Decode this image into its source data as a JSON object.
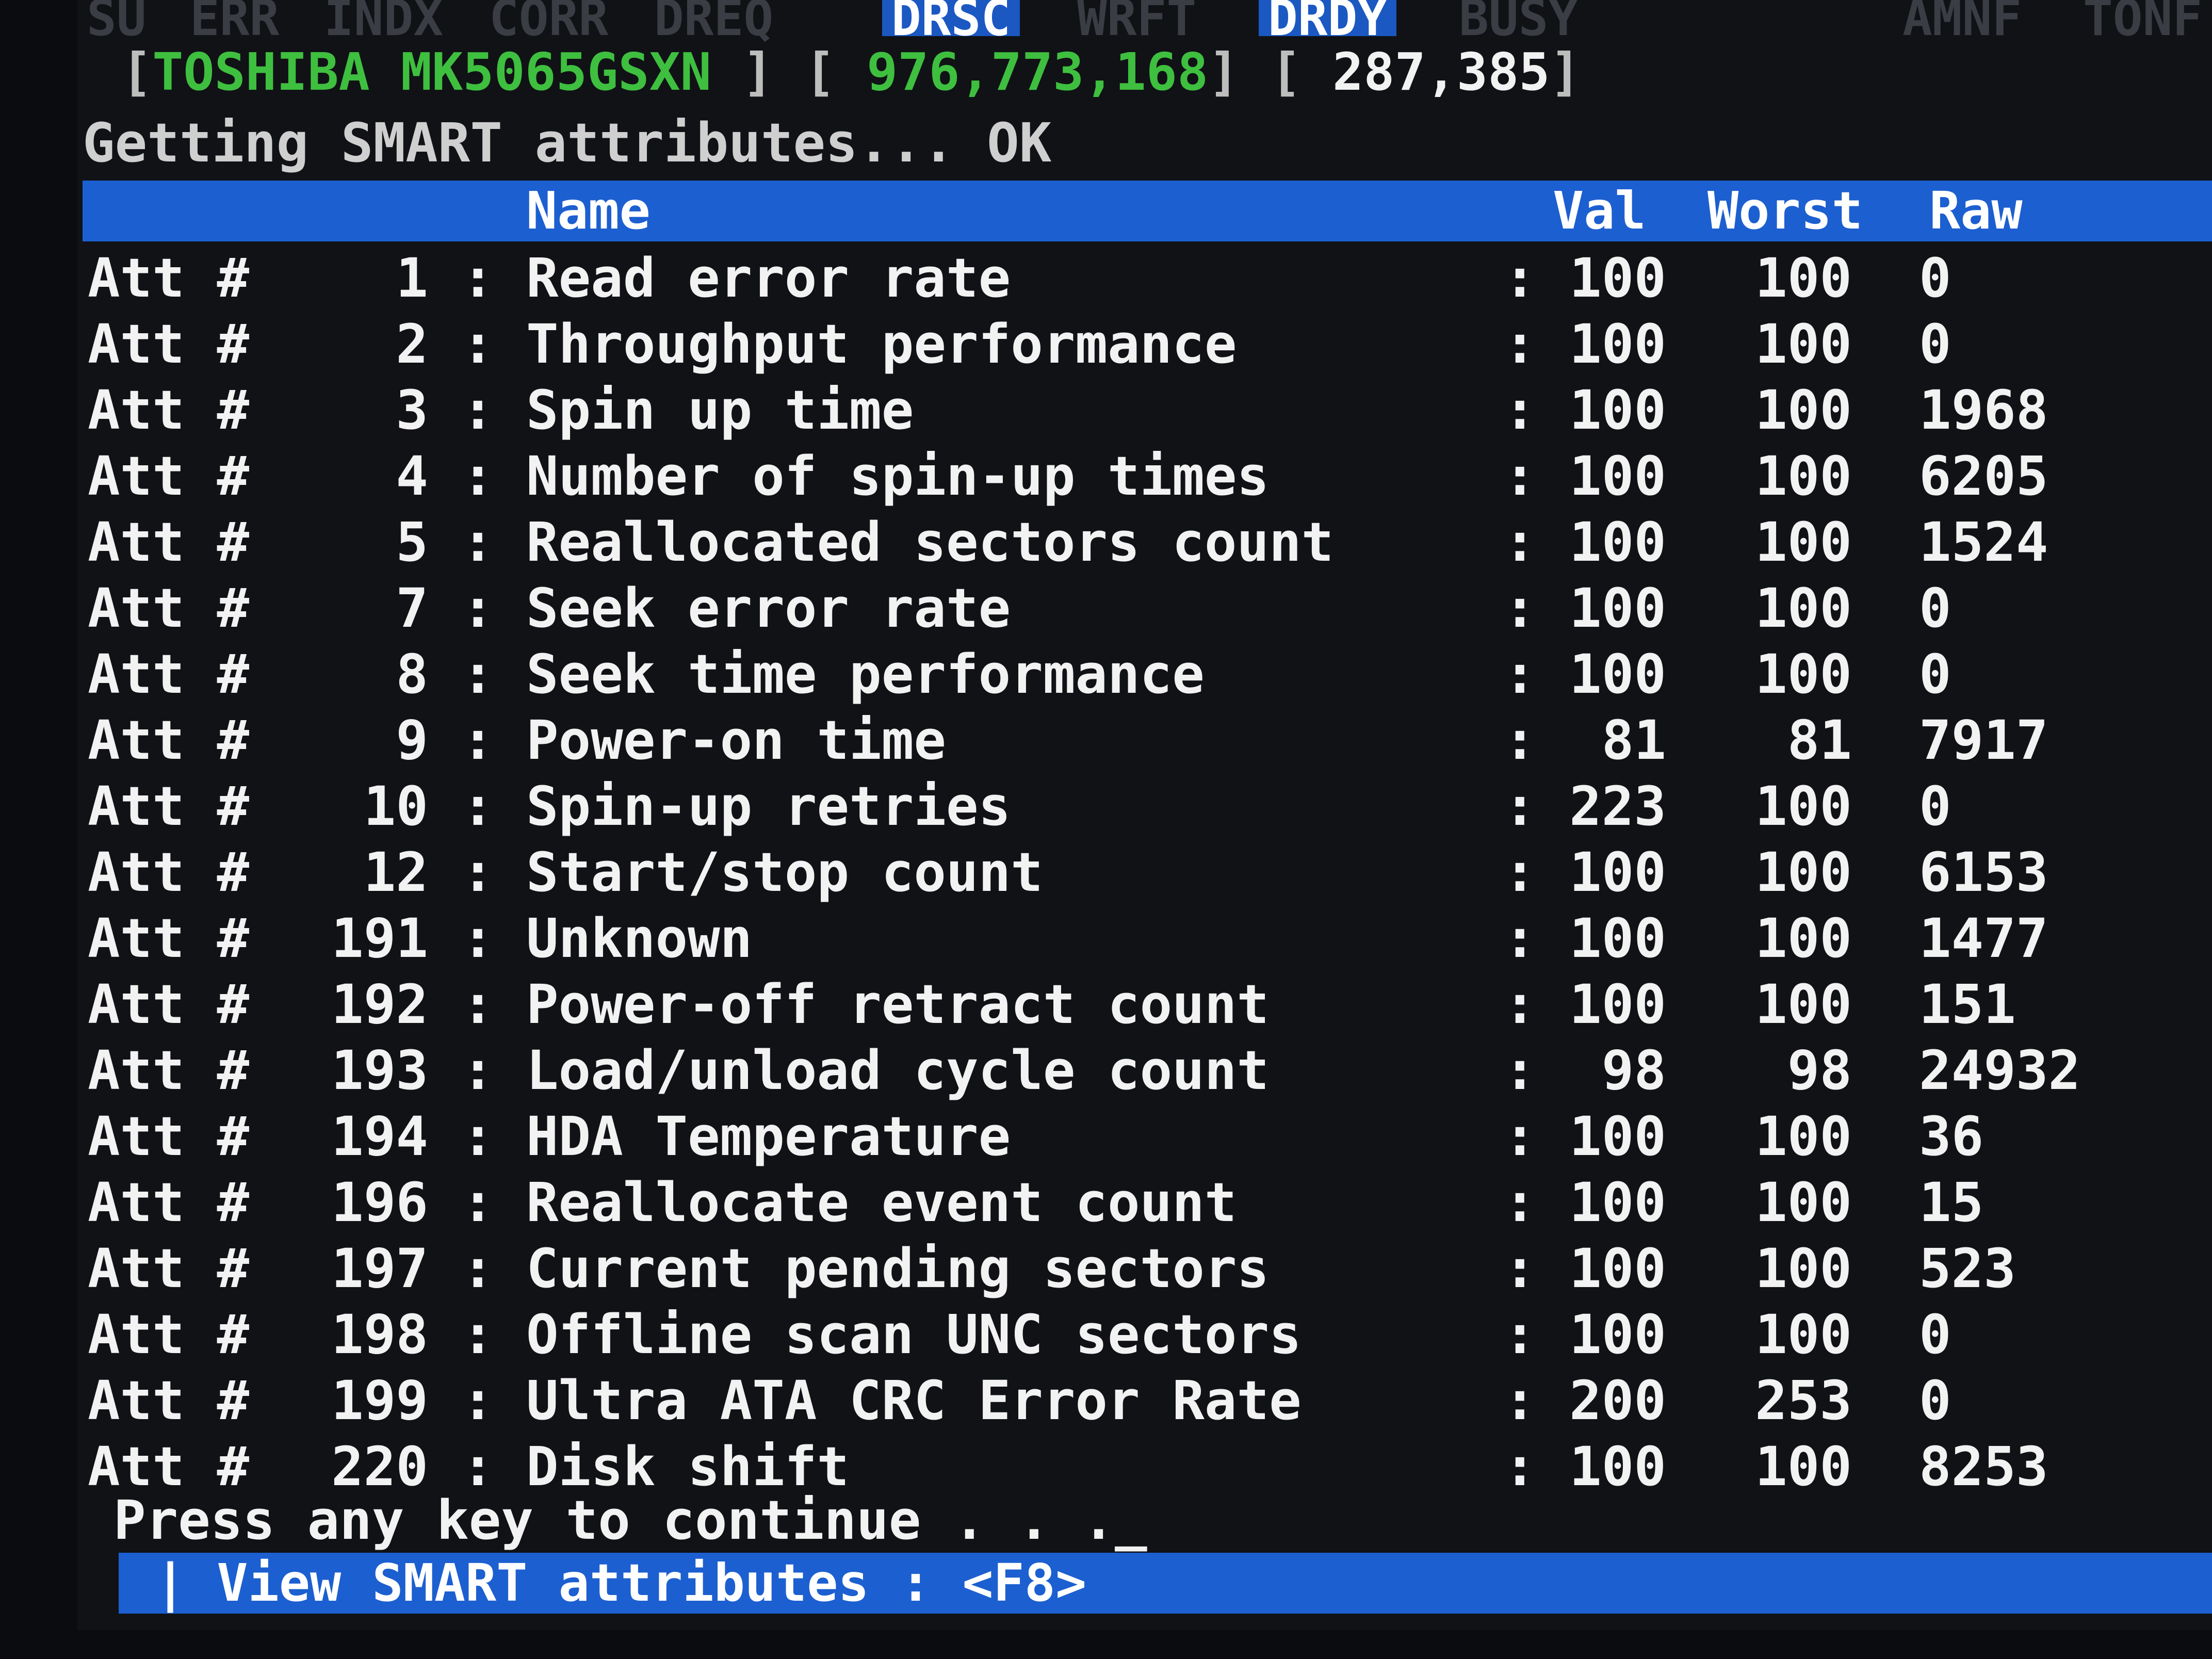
{
  "flags": {
    "items": [
      "SU",
      "ERR",
      "INDX",
      "CORR",
      "DREQ",
      "DRSC",
      "WRFT",
      "DRDY",
      "BUSY",
      "AMNF",
      "TONF"
    ],
    "active": [
      "DRSC",
      "DRDY"
    ]
  },
  "drive": {
    "model": "TOSHIBA MK5065GSXN",
    "sectors": "976,773,168",
    "size": "287,385"
  },
  "status_line": "Getting SMART attributes... OK",
  "table": {
    "headers": {
      "name": "Name",
      "val": "Val",
      "worst": "Worst",
      "raw": "Raw"
    },
    "row_prefix": "Att #",
    "rows": [
      {
        "num": "1",
        "name": "Read error rate",
        "val": "100",
        "worst": "100",
        "raw": "0"
      },
      {
        "num": "2",
        "name": "Throughput performance",
        "val": "100",
        "worst": "100",
        "raw": "0"
      },
      {
        "num": "3",
        "name": "Spin up time",
        "val": "100",
        "worst": "100",
        "raw": "1968"
      },
      {
        "num": "4",
        "name": "Number of spin-up times",
        "val": "100",
        "worst": "100",
        "raw": "6205"
      },
      {
        "num": "5",
        "name": "Reallocated sectors count",
        "val": "100",
        "worst": "100",
        "raw": "1524"
      },
      {
        "num": "7",
        "name": "Seek error rate",
        "val": "100",
        "worst": "100",
        "raw": "0"
      },
      {
        "num": "8",
        "name": "Seek time performance",
        "val": "100",
        "worst": "100",
        "raw": "0"
      },
      {
        "num": "9",
        "name": "Power-on time",
        "val": "81",
        "worst": "81",
        "raw": "7917"
      },
      {
        "num": "10",
        "name": "Spin-up retries",
        "val": "223",
        "worst": "100",
        "raw": "0"
      },
      {
        "num": "12",
        "name": "Start/stop count",
        "val": "100",
        "worst": "100",
        "raw": "6153"
      },
      {
        "num": "191",
        "name": "Unknown",
        "val": "100",
        "worst": "100",
        "raw": "1477"
      },
      {
        "num": "192",
        "name": "Power-off retract count",
        "val": "100",
        "worst": "100",
        "raw": "151"
      },
      {
        "num": "193",
        "name": "Load/unload cycle count",
        "val": "98",
        "worst": "98",
        "raw": "24932"
      },
      {
        "num": "194",
        "name": "HDA Temperature",
        "val": "100",
        "worst": "100",
        "raw": "36"
      },
      {
        "num": "196",
        "name": "Reallocate event count",
        "val": "100",
        "worst": "100",
        "raw": "15"
      },
      {
        "num": "197",
        "name": "Current pending sectors",
        "val": "100",
        "worst": "100",
        "raw": "523"
      },
      {
        "num": "198",
        "name": "Offline scan UNC sectors",
        "val": "100",
        "worst": "100",
        "raw": "0"
      },
      {
        "num": "199",
        "name": "Ultra ATA CRC Error Rate",
        "val": "200",
        "worst": "253",
        "raw": "0"
      },
      {
        "num": "220",
        "name": "Disk shift",
        "val": "100",
        "worst": "100",
        "raw": "8253"
      }
    ]
  },
  "prompt": "Press any key to continue . . ._",
  "footer": "| View SMART attributes : <F8>",
  "colors": {
    "background": "#101216",
    "header_bar": "#1c5fd0",
    "model_text": "#3fbf3f",
    "text": "#f2f2f2"
  }
}
